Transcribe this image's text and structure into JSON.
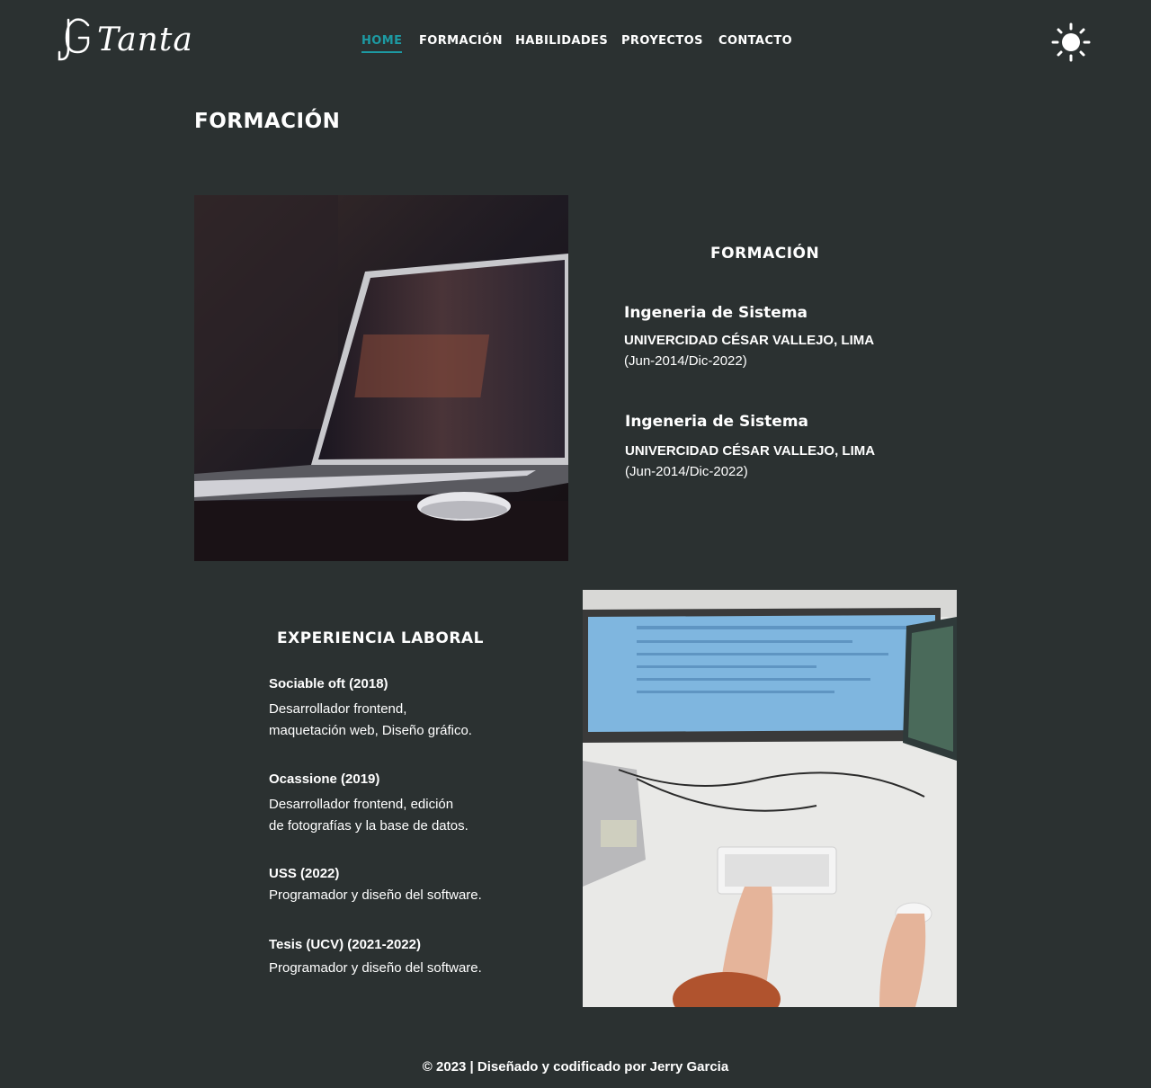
{
  "brand": {
    "name": "Tanta"
  },
  "nav": {
    "items": [
      {
        "label": "HOME",
        "active": true
      },
      {
        "label": "FORMACIÓN"
      },
      {
        "label": "HABILIDADES"
      },
      {
        "label": "PROYECTOS"
      },
      {
        "label": "CONTACTO"
      }
    ],
    "active_color": "#1d9aa3"
  },
  "theme_toggle": {
    "icon": "sun-icon"
  },
  "page": {
    "title": "FORMACIÓN"
  },
  "education": {
    "heading": "FORMACIÓN",
    "items": [
      {
        "degree": "Ingeneria de Sistema",
        "school": "UNIVERCIDAD CÉSAR VALLEJO, LIMA",
        "dates": "(Jun-2014/Dic-2022)"
      },
      {
        "degree": "Ingeneria de Sistema",
        "school": "UNIVERCIDAD CÉSAR VALLEJO, LIMA",
        "dates": "(Jun-2014/Dic-2022)"
      }
    ]
  },
  "experience": {
    "heading": "EXPERIENCIA LABORAL",
    "items": [
      {
        "company": "Sociable oft (2018)",
        "lines": [
          "Desarrollador frontend,",
          "maquetación web, Diseño gráfico."
        ]
      },
      {
        "company": "Ocassione (2019)",
        "lines": [
          "Desarrollador frontend, edición",
          "de fotografías y la base de datos."
        ]
      },
      {
        "company": "USS (2022)",
        "lines": [
          "Programador y diseño del software."
        ]
      },
      {
        "company": "Tesis (UCV) (2021-2022)",
        "lines": [
          "Programador y diseño del software."
        ]
      }
    ]
  },
  "footer": {
    "text": "© 2023 | Diseñado y codificado por Jerry Garcia"
  },
  "colors": {
    "background": "#2b3131",
    "text": "#ffffff",
    "accent": "#1d9aa3"
  }
}
